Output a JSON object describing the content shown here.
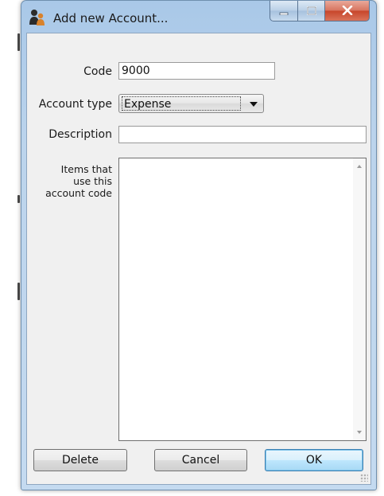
{
  "window": {
    "title": "Add new Account...",
    "icons": {
      "app": "people-icon",
      "minimize": "minimize-icon",
      "maximize": "maximize-icon",
      "close": "close-icon"
    }
  },
  "form": {
    "code_label": "Code",
    "code_value": "9000",
    "account_type_label": "Account type",
    "account_type_value": "Expense",
    "description_label": "Description",
    "description_value": "",
    "items_label_lines": [
      "Items that",
      "use this",
      "account code"
    ]
  },
  "buttons": {
    "delete": "Delete",
    "cancel": "Cancel",
    "ok": "OK"
  },
  "colors": {
    "title_bar": "#bcd4ec",
    "close_button": "#c7452a",
    "default_button_border": "#3c7fb1"
  }
}
